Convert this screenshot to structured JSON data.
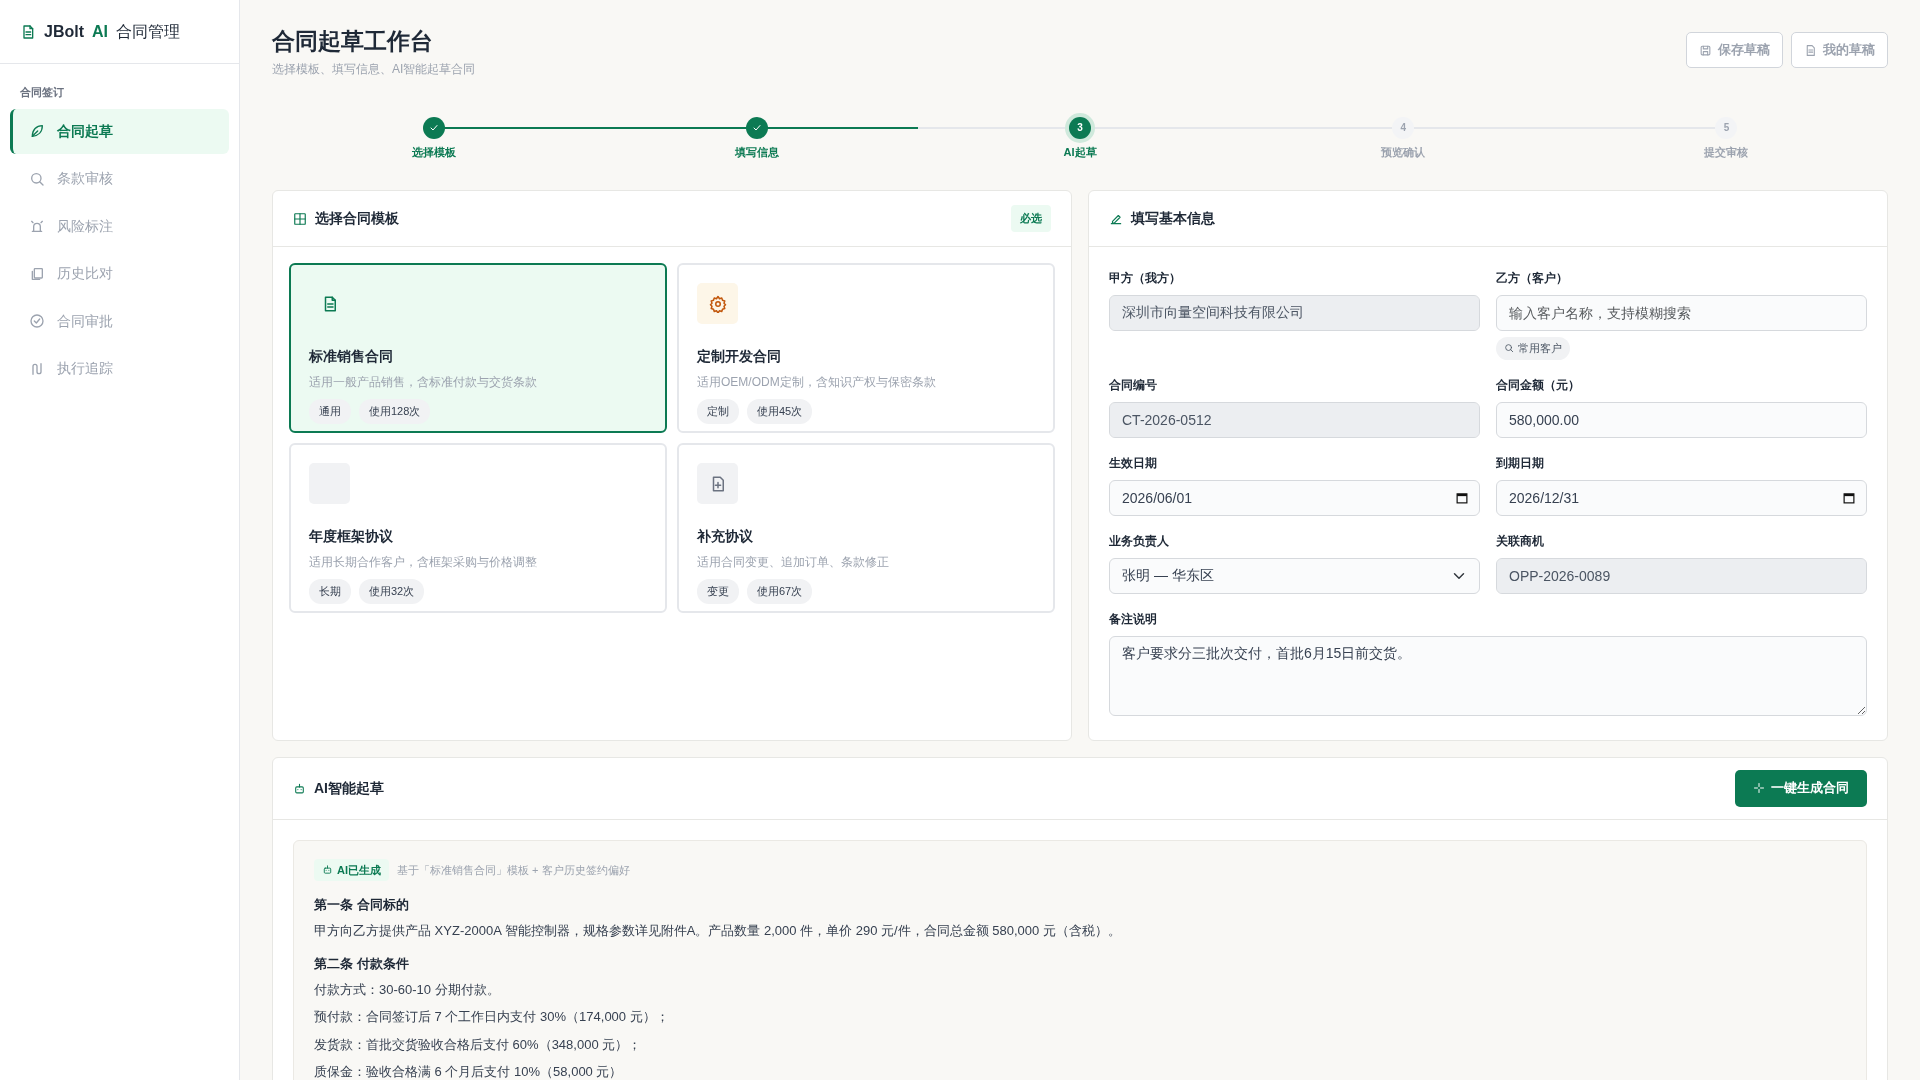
{
  "brand": {
    "name": "JBolt",
    "ai": "AI",
    "suffix": "合同管理"
  },
  "sidebar": {
    "section": "合同签订",
    "items": [
      {
        "label": "合同起草",
        "selected": true
      },
      {
        "label": "条款审核",
        "selected": false
      },
      {
        "label": "风险标注",
        "selected": false
      },
      {
        "label": "历史比对",
        "selected": false
      },
      {
        "label": "合同审批",
        "selected": false
      },
      {
        "label": "执行追踪",
        "selected": false
      }
    ]
  },
  "header": {
    "title": "合同起草工作台",
    "subtitle": "选择模板、填写信息、AI智能起草合同",
    "buttons": [
      "保存草稿",
      "我的草稿"
    ]
  },
  "steps": [
    {
      "label": "选择模板",
      "done": true,
      "selected": false
    },
    {
      "label": "填写信息",
      "done": true,
      "selected": false
    },
    {
      "label": "AI起草",
      "number": "3",
      "done": false,
      "selected": true
    },
    {
      "label": "预览确认",
      "number": "4",
      "done": false,
      "selected": false
    },
    {
      "label": "提交审核",
      "number": "5",
      "done": false,
      "selected": false
    }
  ],
  "templates_panel": {
    "title": "选择合同模板",
    "badge": "必选",
    "templates": [
      {
        "name": "标准销售合同",
        "desc": "适用一般产品销售，含标准付款与交货条款",
        "tags": [
          "通用",
          "使用128次"
        ],
        "selected": true
      },
      {
        "name": "定制开发合同",
        "desc": "适用OEM/ODM定制，含知识产权与保密条款",
        "tags": [
          "定制",
          "使用45次"
        ],
        "selected": false
      },
      {
        "name": "年度框架协议",
        "desc": "适用长期合作客户，含框架采购与价格调整",
        "tags": [
          "长期",
          "使用32次"
        ],
        "selected": false
      },
      {
        "name": "补充协议",
        "desc": "适用合同变更、追加订单、条款修正",
        "tags": [
          "变更",
          "使用67次"
        ],
        "selected": false
      }
    ]
  },
  "form_panel": {
    "title": "填写基本信息",
    "fields": [
      {
        "label": "甲方（我方）",
        "kind": "text",
        "value": "深圳市向量空间科技有限公司",
        "readonly": true
      },
      {
        "label": "乙方（客户）",
        "kind": "text",
        "placeholder": "输入客户名称，支持模糊搜索",
        "readonly": false,
        "chip": "常用客户"
      },
      {
        "label": "合同编号",
        "kind": "text",
        "value": "CT-2026-0512",
        "readonly": true
      },
      {
        "label": "合同金额（元）",
        "kind": "text",
        "value": "580,000.00",
        "readonly": false
      },
      {
        "label": "生效日期",
        "kind": "date",
        "value": "2026/06/01",
        "readonly": false
      },
      {
        "label": "到期日期",
        "kind": "date",
        "value": "2026/12/31",
        "readonly": false
      },
      {
        "label": "业务负责人",
        "kind": "select",
        "value": "张明 — 华东区",
        "readonly": false
      },
      {
        "label": "关联商机",
        "kind": "text",
        "value": "OPP-2026-0089",
        "readonly": true
      },
      {
        "label": "备注说明",
        "kind": "textarea",
        "value": "客户要求分三批次交付，首批6月15日前交货。",
        "readonly": false
      }
    ]
  },
  "ai_panel": {
    "title": "AI智能起草",
    "button": "一键生成合同",
    "badge": "AI已生成",
    "note": "基于「标准销售合同」模板 + 客户历史签约偏好",
    "clauses": [
      {
        "heading": "第一条 合同标的",
        "lines": [
          "甲方向乙方提供产品 XYZ-2000A 智能控制器，规格参数详见附件A。产品数量 2,000 件，单价 290 元/件，合同总金额 580,000 元（含税）。"
        ]
      },
      {
        "heading": "第二条 付款条件",
        "lines": [
          "付款方式：30-60-10 分期付款。",
          "预付款：合同签订后 7 个工作日内支付 30%（174,000 元）；",
          "发货款：首批交货验收合格后支付 60%（348,000 元）；",
          "质保金：验收合格满 6 个月后支付 10%（58,000 元）"
        ]
      }
    ]
  }
}
